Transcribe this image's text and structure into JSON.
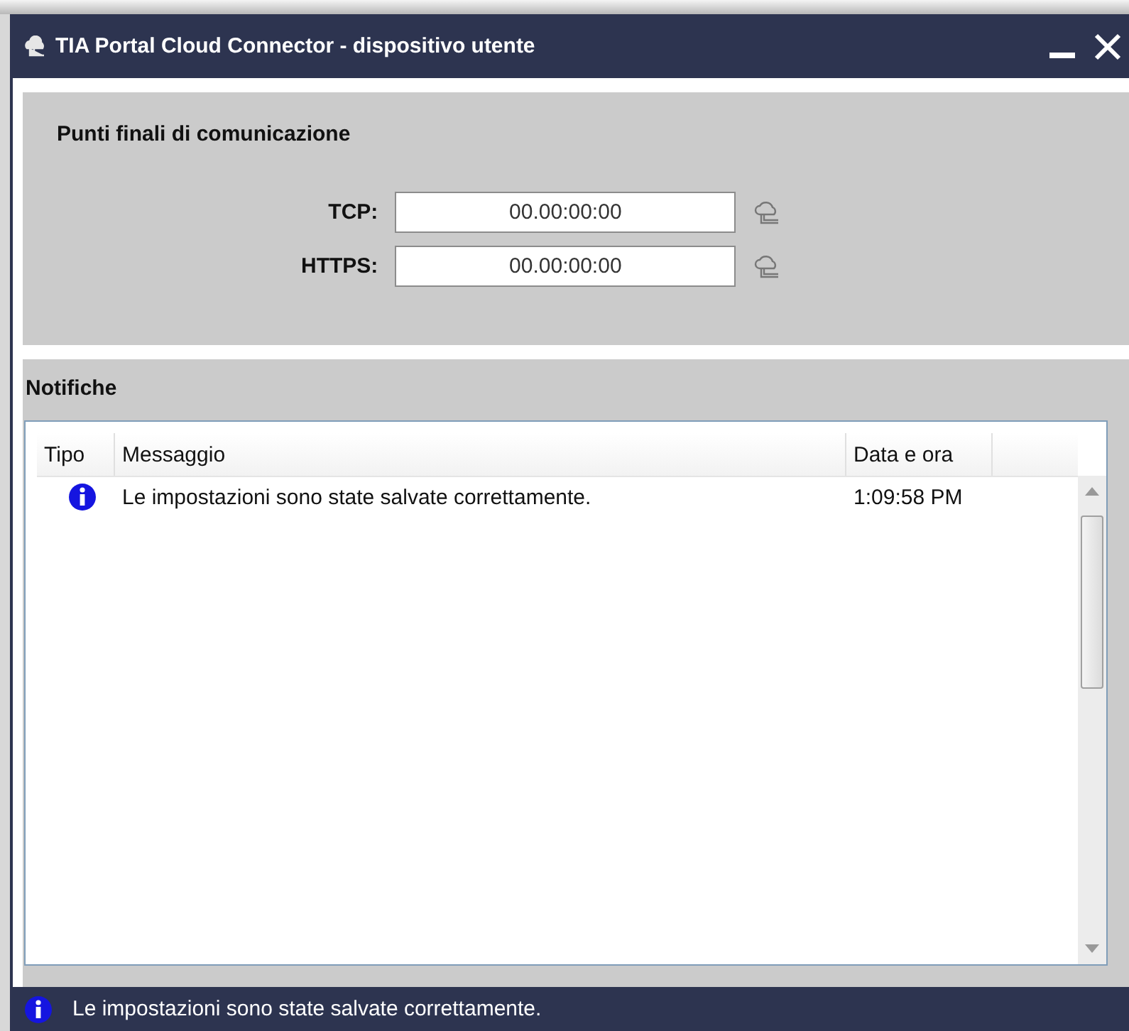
{
  "window": {
    "title": "TIA Portal Cloud Connector - dispositivo utente"
  },
  "endpoints": {
    "title": "Punti finali di comunicazione",
    "rows": [
      {
        "label": "TCP:",
        "value": "00.00:00:00"
      },
      {
        "label": "HTTPS:",
        "value": "00.00:00:00"
      }
    ]
  },
  "notifications": {
    "title": "Notifiche",
    "columns": [
      "Tipo",
      "Messaggio",
      "Data e ora"
    ],
    "rows": [
      {
        "kind": "info",
        "message": "Le impostazioni sono state salvate correttamente.",
        "time": "1:09:58 PM"
      }
    ]
  },
  "status_bar": {
    "kind": "info",
    "text": "Le impostazioni sono state salvate correttamente."
  }
}
